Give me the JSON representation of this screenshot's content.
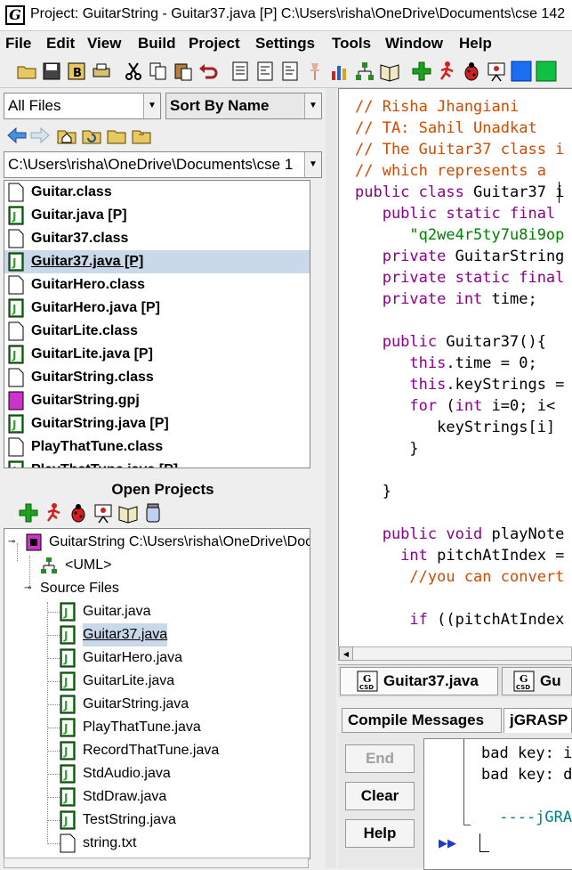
{
  "window": {
    "title": "Project: GuitarString  - Guitar37.java [P]  C:\\Users\\risha\\OneDrive\\Documents\\cse 142"
  },
  "app_icon": "G",
  "menu": [
    "File",
    "Edit",
    "View",
    "Build",
    "Project",
    "Settings",
    "Tools",
    "Window",
    "Help"
  ],
  "toolbar_icons": [
    "open-folder-icon",
    "save-icon",
    "backup-icon",
    "print-icon",
    "cut-icon",
    "copy-icon",
    "paste-icon",
    "undo-icon",
    "doc-icon",
    "doc2-icon",
    "doc3-icon",
    "pin-icon",
    "chart-icon",
    "uml-icon",
    "book-icon",
    "add-icon",
    "run-icon",
    "debug-icon",
    "present-icon",
    "blue-square-icon",
    "green-square-icon"
  ],
  "browser": {
    "filter": "All Files",
    "sort": "Sort By Name",
    "path": "C:\\Users\\risha\\OneDrive\\Documents\\cse 1",
    "files": [
      {
        "name": "Guitar.class",
        "type": "class"
      },
      {
        "name": "Guitar.java [P]",
        "type": "java"
      },
      {
        "name": "Guitar37.class",
        "type": "class"
      },
      {
        "name": "Guitar37.java [P]",
        "type": "java",
        "selected": true
      },
      {
        "name": "GuitarHero.class",
        "type": "class"
      },
      {
        "name": "GuitarHero.java [P]",
        "type": "java"
      },
      {
        "name": "GuitarLite.class",
        "type": "class"
      },
      {
        "name": "GuitarLite.java [P]",
        "type": "java"
      },
      {
        "name": "GuitarString.class",
        "type": "class"
      },
      {
        "name": "GuitarString.gpj",
        "type": "gpj"
      },
      {
        "name": "GuitarString.java [P]",
        "type": "java"
      },
      {
        "name": "PlayThatTune.class",
        "type": "class"
      },
      {
        "name": "PlayThatTune.java [P]",
        "type": "java"
      }
    ]
  },
  "open_projects": {
    "title": "Open Projects",
    "project": "GuitarString  C:\\Users\\risha\\OneDrive\\Documents",
    "uml": "<UML>",
    "source_files_label": "Source Files",
    "sources": [
      {
        "name": "Guitar.java",
        "type": "java"
      },
      {
        "name": "Guitar37.java",
        "type": "java",
        "selected": true
      },
      {
        "name": "GuitarHero.java",
        "type": "java"
      },
      {
        "name": "GuitarLite.java",
        "type": "java"
      },
      {
        "name": "GuitarString.java",
        "type": "java"
      },
      {
        "name": "PlayThatTune.java",
        "type": "java"
      },
      {
        "name": "RecordThatTune.java",
        "type": "java"
      },
      {
        "name": "StdAudio.java",
        "type": "java"
      },
      {
        "name": "StdDraw.java",
        "type": "java"
      },
      {
        "name": "TestString.java",
        "type": "java"
      },
      {
        "name": "string.txt",
        "type": "txt"
      }
    ]
  },
  "editor": {
    "lines": [
      [
        {
          "t": "// Risha Jhangiani",
          "c": "comment"
        }
      ],
      [
        {
          "t": "// TA: Sahil Unadkat",
          "c": "comment"
        }
      ],
      [
        {
          "t": "// The Guitar37 class i",
          "c": "comment"
        }
      ],
      [
        {
          "t": "// which represents a ",
          "c": "comment"
        }
      ],
      [
        {
          "t": "public class ",
          "c": "kw"
        },
        {
          "t": "Guitar37 i",
          "c": "norm"
        }
      ],
      [
        {
          "t": "   public static final",
          "c": "kw"
        }
      ],
      [
        {
          "t": "      \"q2we4r5ty7u8i9op",
          "c": "str"
        }
      ],
      [
        {
          "t": "   private ",
          "c": "kw"
        },
        {
          "t": "GuitarString",
          "c": "norm"
        }
      ],
      [
        {
          "t": "   private static final",
          "c": "kw"
        }
      ],
      [
        {
          "t": "   private int ",
          "c": "kw"
        },
        {
          "t": "time;",
          "c": "norm"
        }
      ],
      [
        {
          "t": "",
          "c": "norm"
        }
      ],
      [
        {
          "t": "   public ",
          "c": "kw"
        },
        {
          "t": "Guitar37(){",
          "c": "norm"
        }
      ],
      [
        {
          "t": "      this",
          "c": "kw"
        },
        {
          "t": ".time = 0;",
          "c": "norm"
        }
      ],
      [
        {
          "t": "      this",
          "c": "kw"
        },
        {
          "t": ".keyStrings =",
          "c": "norm"
        }
      ],
      [
        {
          "t": "      for ",
          "c": "kw"
        },
        {
          "t": "(",
          "c": "norm"
        },
        {
          "t": "int ",
          "c": "kw"
        },
        {
          "t": "i=0; i<",
          "c": "norm"
        }
      ],
      [
        {
          "t": "         keyStrings[i]",
          "c": "norm"
        }
      ],
      [
        {
          "t": "      }",
          "c": "norm"
        }
      ],
      [
        {
          "t": "",
          "c": "norm"
        }
      ],
      [
        {
          "t": "   }",
          "c": "norm"
        }
      ],
      [
        {
          "t": "",
          "c": "norm"
        }
      ],
      [
        {
          "t": "   public void ",
          "c": "kw"
        },
        {
          "t": "playNote",
          "c": "norm"
        }
      ],
      [
        {
          "t": "     int ",
          "c": "kw"
        },
        {
          "t": "pitchAtIndex =",
          "c": "norm"
        }
      ],
      [
        {
          "t": "      //you can convert",
          "c": "comment"
        }
      ],
      [
        {
          "t": "",
          "c": "norm"
        }
      ],
      [
        {
          "t": "      if ",
          "c": "kw"
        },
        {
          "t": "((pitchAtIndex",
          "c": "norm"
        }
      ]
    ]
  },
  "doc_tabs": [
    "Guitar37.java",
    "Gu"
  ],
  "message_tabs": [
    "Compile Messages",
    "jGRASP"
  ],
  "buttons": {
    "end": "End",
    "clear": "Clear",
    "help": "Help"
  },
  "console": {
    "lines": [
      "bad key: i",
      "bad key: d",
      "",
      " ----jGRAS"
    ]
  },
  "colors": {
    "comment": "#d04a00",
    "keyword": "#8b008b",
    "string": "#008000",
    "selection": "#c9d9ea",
    "java_icon": "#2e9e2e",
    "gpj_icon": "#cc33cc"
  }
}
